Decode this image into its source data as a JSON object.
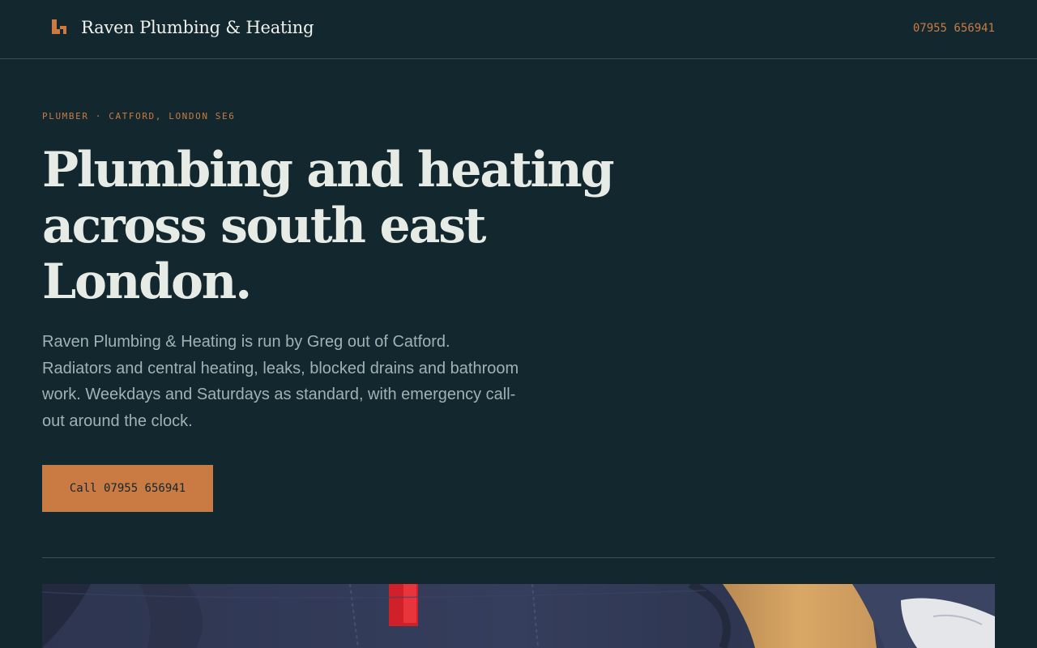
{
  "header": {
    "logo_icon": "raven-logo-icon",
    "brand": "Raven Plumbing & Heating",
    "phone": "07955 656941"
  },
  "hero": {
    "eyebrow": "PLUMBER · CATFORD, LONDON SE6",
    "headline_lines": [
      "Plumbing and heating",
      "across south east",
      "London."
    ],
    "intro": "Raven Plumbing & Heating is run by Greg out of Catford. Radiators and central heating, leaks, blocked drains and bathroom work. Weekdays and Saturdays as standard, with emergency call-out around the clock.",
    "cta_label": "Call 07955 656941"
  },
  "colors": {
    "background": "#12272e",
    "accent": "#c97b43",
    "headline": "#e7ebe5",
    "body_text": "#9fb3b4",
    "rule": "#3a5058"
  }
}
